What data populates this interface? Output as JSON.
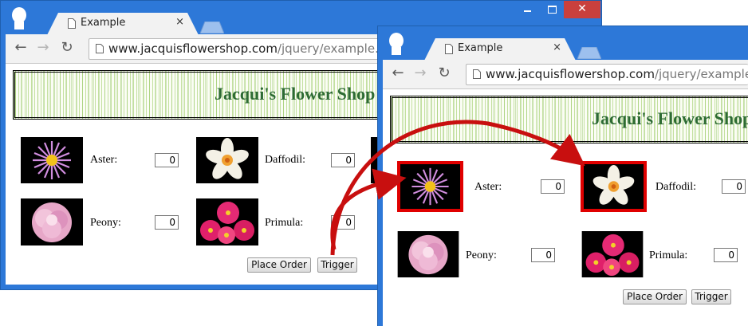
{
  "browser": {
    "tab_title": "Example",
    "tab_close": "×",
    "url_host": "www.jacquisflowershop.com",
    "url_path": "/jquery/example.html",
    "close_glyph": "✕",
    "back_glyph": "←",
    "forward_glyph": "→",
    "reload_glyph": "↻"
  },
  "page": {
    "title": "Jacqui's Flower Shop",
    "flowers": [
      {
        "label": "Aster:",
        "qty": "0"
      },
      {
        "label": "Daffodil:",
        "qty": "0"
      },
      {
        "label": "Peony:",
        "qty": "0"
      },
      {
        "label": "Primula:",
        "qty": "0"
      }
    ],
    "place_order_label": "Place Order",
    "trigger_label": "Trigger"
  },
  "colors": {
    "window_frame": "#2d78d8",
    "close_button": "#c9403d",
    "header_text": "#2d6b33",
    "highlight_border": "#e00000",
    "arrow": "#c80f0f"
  }
}
